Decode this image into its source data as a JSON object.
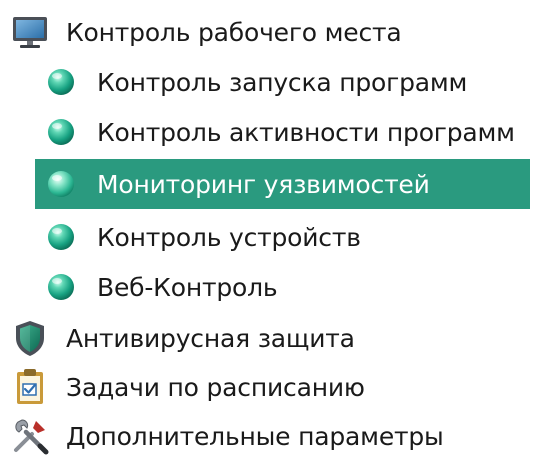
{
  "colors": {
    "selection_bg": "#2a9a7f",
    "selection_text": "#ffffff",
    "text": "#1a1a1a",
    "sphere_accent": "#1aa58a"
  },
  "tree": {
    "workplace": {
      "label": "Контроль рабочего места",
      "icon": "monitor-icon",
      "children": [
        {
          "label": "Контроль запуска программ",
          "icon": "green-sphere-icon"
        },
        {
          "label": "Контроль активности программ",
          "icon": "green-sphere-icon"
        },
        {
          "label": "Мониторинг уязвимостей",
          "icon": "green-sphere-icon",
          "selected": true
        },
        {
          "label": "Контроль устройств",
          "icon": "green-sphere-icon"
        },
        {
          "label": "Веб-Контроль",
          "icon": "green-sphere-icon"
        }
      ]
    },
    "antivirus": {
      "label": "Антивирусная защита",
      "icon": "shield-icon"
    },
    "scheduled_tasks": {
      "label": "Задачи по расписанию",
      "icon": "clipboard-icon"
    },
    "advanced": {
      "label": "Дополнительные параметры",
      "icon": "tools-icon"
    }
  }
}
